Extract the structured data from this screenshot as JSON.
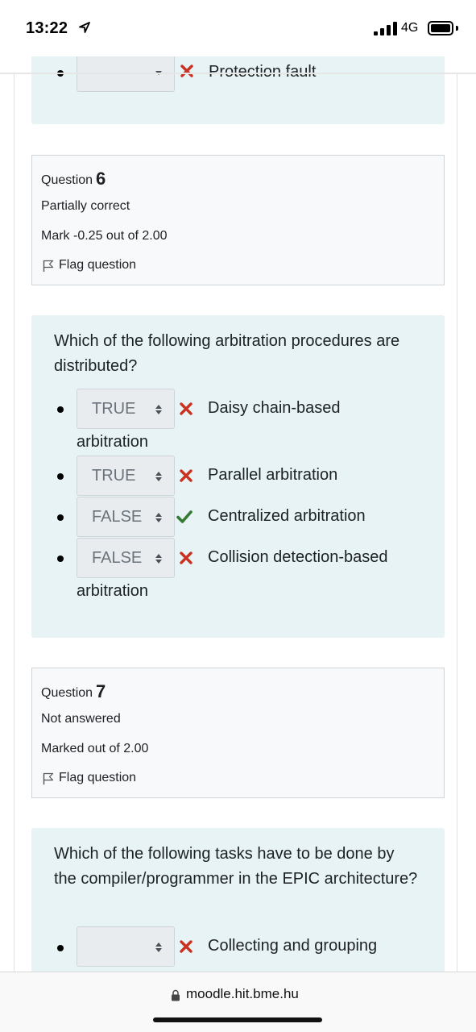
{
  "status": {
    "time": "13:22",
    "network": "4G",
    "location_icon": "location-arrow-icon",
    "signal_icon": "signal-bars-icon",
    "battery_icon": "battery-icon"
  },
  "previous_question": {
    "partial_answer_label": "Protection fault"
  },
  "question6": {
    "label": "Question",
    "number": "6",
    "state": "Partially correct",
    "grade": "Mark -0.25 out of 2.00",
    "flag_label": "Flag question",
    "text": "Which of the following arbitration procedures are distributed?",
    "answers": [
      {
        "selected": "TRUE",
        "result": "incorrect",
        "label_line1": "Daisy chain-based",
        "label_line2": "arbitration"
      },
      {
        "selected": "TRUE",
        "result": "incorrect",
        "label_line1": "Parallel arbitration",
        "label_line2": ""
      },
      {
        "selected": "FALSE",
        "result": "correct",
        "label_line1": "Centralized arbitration",
        "label_line2": ""
      },
      {
        "selected": "FALSE",
        "result": "incorrect",
        "label_line1": "Collision detection-based",
        "label_line2": "arbitration"
      }
    ]
  },
  "question7": {
    "label": "Question",
    "number": "7",
    "state": "Not answered",
    "grade": "Marked out of 2.00",
    "flag_label": "Flag question",
    "text": "Which of the following tasks have to be done by the compiler/programmer in the EPIC architecture?",
    "answers": [
      {
        "selected": "",
        "result": "incorrect",
        "label_line1": "Collecting and grouping"
      }
    ]
  },
  "address_bar": {
    "url": "moodle.hit.bme.hu",
    "lock_icon": "lock-icon"
  },
  "colors": {
    "panel_bg": "#e7f3f5",
    "info_bg": "#f8f9fa",
    "incorrect": "#ca3120",
    "correct": "#357a32"
  }
}
